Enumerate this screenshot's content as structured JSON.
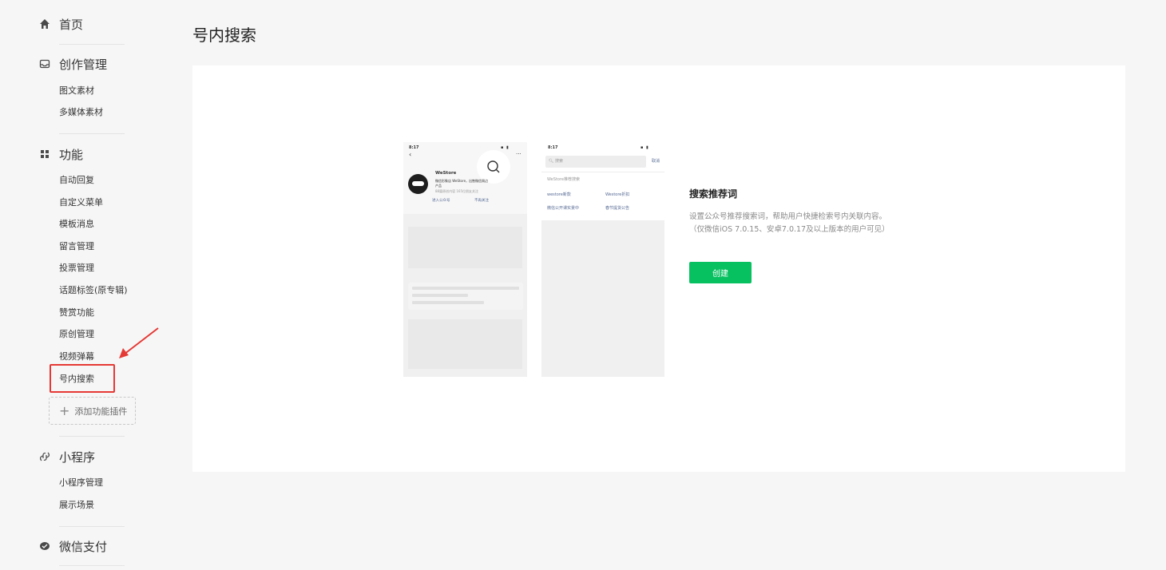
{
  "sidebar": {
    "home": {
      "label": "首页",
      "icon": "home-icon"
    },
    "creation": {
      "label": "创作管理",
      "icon": "inbox-icon",
      "items": [
        "图文素材",
        "多媒体素材"
      ]
    },
    "features": {
      "label": "功能",
      "icon": "grid-icon",
      "items": [
        "自动回复",
        "自定义菜单",
        "模板消息",
        "留言管理",
        "投票管理",
        "话题标签(原专辑)",
        "赞赏功能",
        "原创管理",
        "视频弹幕",
        "号内搜索"
      ],
      "add_plugin": "添加功能插件"
    },
    "miniprogram": {
      "label": "小程序",
      "icon": "link-icon",
      "items": [
        "小程序管理",
        "展示场景"
      ]
    },
    "pay": {
      "label": "微信支付",
      "icon": "wechat-pay-icon"
    }
  },
  "main": {
    "title": "号内搜索",
    "recommend_title": "搜索推荐词",
    "recommend_desc_1": "设置公众号推荐搜索词，帮助用户快捷检索号内关联内容。",
    "recommend_desc_2": "（仅微信iOS 7.0.15、安卓7.0.17及以上版本的用户可见）",
    "create_button": "创建"
  },
  "phone1": {
    "time": "8:17",
    "account_name": "WeStore",
    "desc_line1": "微信形象店 WeStore，出售微信周边",
    "desc_line2": "产品",
    "meta": "88篇原创内容  165位朋友关注",
    "enter_button": "进入公众号",
    "unfollow_button": "不再关注"
  },
  "phone2": {
    "time": "8:17",
    "search_placeholder": "搜索",
    "cancel": "取消",
    "recommend_label": "WeStore推荐搜索",
    "keywords": [
      "westore新款",
      "Westore折扣",
      "微信公开课实景中",
      "春节提货公告"
    ]
  },
  "colors": {
    "accent": "#07c160",
    "highlight": "#e53935",
    "link": "#576b95"
  }
}
